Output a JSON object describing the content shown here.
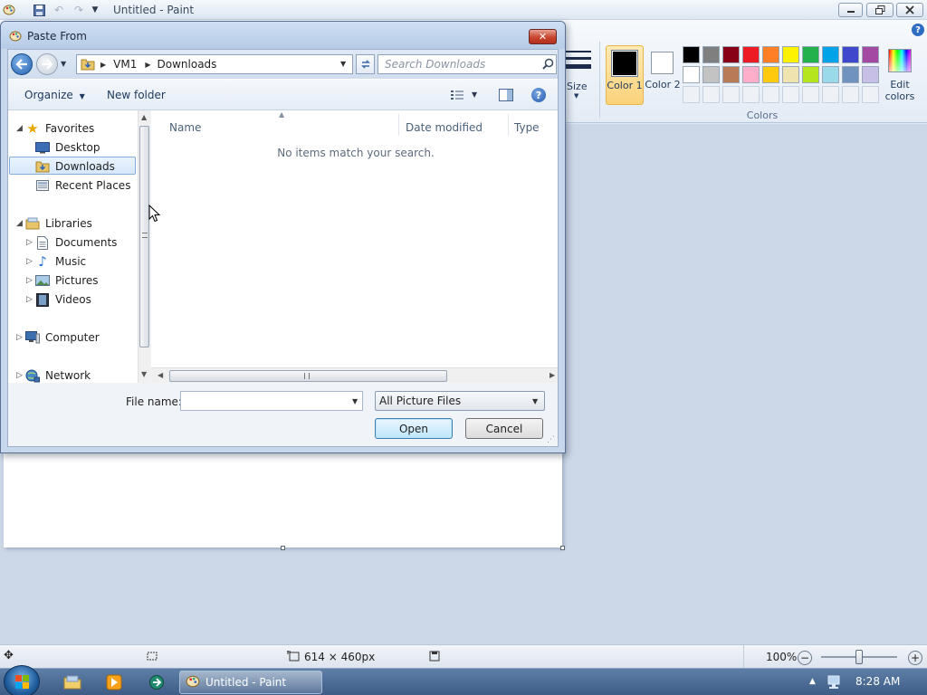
{
  "paint": {
    "title": "Untitled - Paint",
    "ribbon": {
      "size_label": "Size",
      "color1_label": "Color 1",
      "color2_label": "Color 2",
      "edit_colors_label": "Edit colors",
      "colors_group_label": "Colors",
      "palette_row1": [
        "#000000",
        "#7f7f7f",
        "#880015",
        "#ed1c24",
        "#ff7f27",
        "#fff200",
        "#22b14c",
        "#00a2e8",
        "#3f48cc",
        "#a349a4"
      ],
      "palette_row2": [
        "#ffffff",
        "#c3c3c3",
        "#b97a57",
        "#ffaec9",
        "#ffc90e",
        "#efe4b0",
        "#b5e61d",
        "#99d9ea",
        "#7092be",
        "#c8bfe7"
      ],
      "color1": "#000000",
      "color2": "#ffffff"
    },
    "status": {
      "canvas_size": "614 × 460px",
      "zoom": "100%",
      "zoom_level_fraction": 0.5
    }
  },
  "dialog": {
    "title": "Paste From",
    "breadcrumb": [
      "VM1",
      "Downloads"
    ],
    "search_placeholder": "Search Downloads",
    "organize_label": "Organize",
    "new_folder_label": "New folder",
    "nav": {
      "favorites": "Favorites",
      "desktop": "Desktop",
      "downloads": "Downloads",
      "recent": "Recent Places",
      "libraries": "Libraries",
      "documents": "Documents",
      "music": "Music",
      "pictures": "Pictures",
      "videos": "Videos",
      "computer": "Computer",
      "network": "Network"
    },
    "columns": {
      "name": "Name",
      "date": "Date modified",
      "type": "Type"
    },
    "empty_message": "No items match your search.",
    "filename_label": "File name:",
    "filename_value": "",
    "filetype_value": "All Picture Files",
    "open_label": "Open",
    "cancel_label": "Cancel"
  },
  "taskbar": {
    "task_label": "Untitled - Paint",
    "clock": "8:28 AM"
  }
}
